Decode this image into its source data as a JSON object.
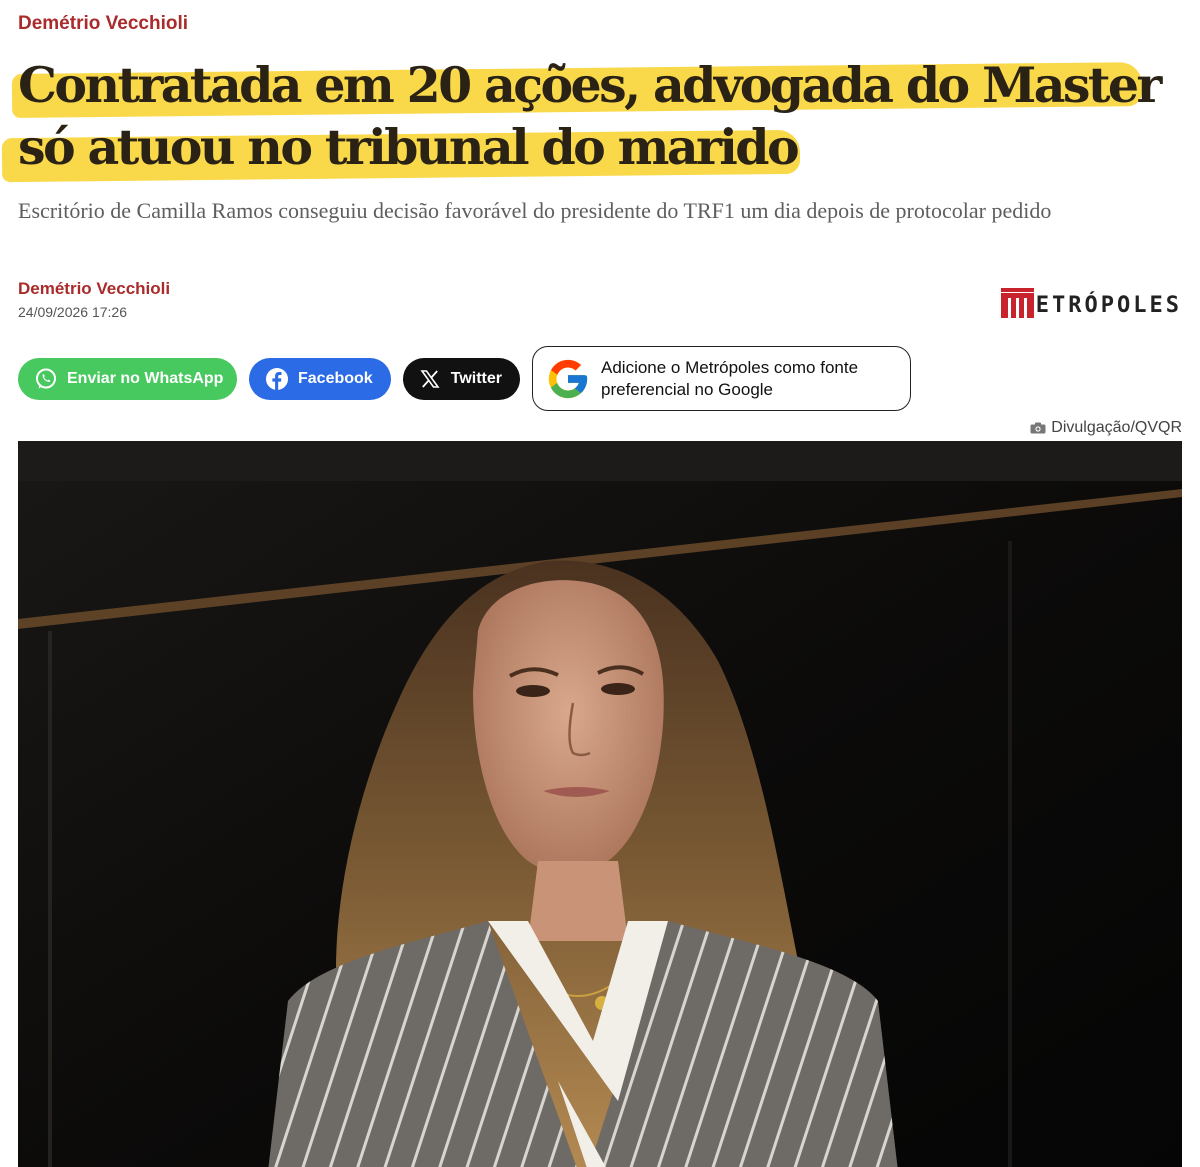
{
  "article": {
    "kicker": "Demétrio Vecchioli",
    "headline_line1": "Contratada em 20 ações, advogada do Master",
    "headline_line2": "só atuou no tribunal do marido",
    "subtitle": "Escritório de Camilla Ramos conseguiu decisão favorável do presidente do TRF1 um dia depois de protocolar pedido",
    "author": "Demétrio Vecchioli",
    "datetime": "24/09/2026 17:26",
    "photo_credit": "Divulgação/QVQR"
  },
  "brand": {
    "logo_text": "ETRÓPOLES",
    "logo_color": "#c8232c",
    "accent_red": "#a92b2b",
    "highlight_yellow": "#f9d94a"
  },
  "share": {
    "whatsapp": {
      "label": "Enviar no WhatsApp",
      "icon": "whatsapp-icon",
      "color": "#48c95f"
    },
    "facebook": {
      "label": "Facebook",
      "icon": "facebook-icon",
      "color": "#2b6be6"
    },
    "twitter": {
      "label": "Twitter",
      "icon": "x-icon",
      "color": "#111111"
    },
    "google": {
      "line1": "Adicione o Metrópoles como fonte",
      "line2": "preferencial no Google",
      "icon": "google-icon"
    }
  }
}
